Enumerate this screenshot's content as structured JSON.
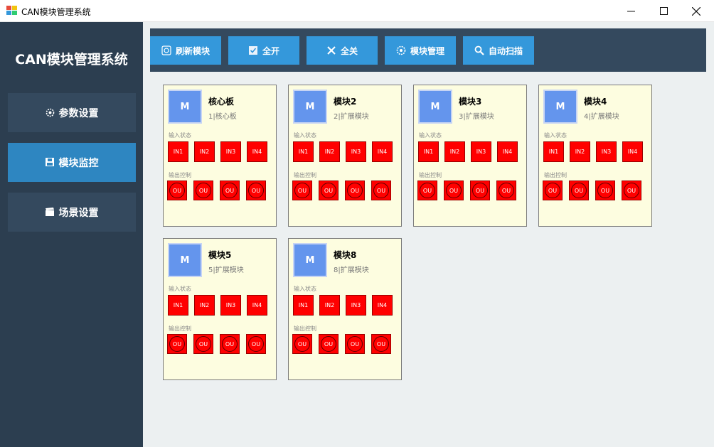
{
  "window": {
    "title": "CAN模块管理系统"
  },
  "sidebar": {
    "title": "CAN模块管理系统",
    "items": [
      {
        "label": "参数设置",
        "icon": "gear-icon"
      },
      {
        "label": "模块监控",
        "icon": "save-icon",
        "active": true
      },
      {
        "label": "场景设置",
        "icon": "clapperboard-icon"
      }
    ]
  },
  "toolbar": {
    "buttons": [
      {
        "label": "刷新模块",
        "icon": "refresh-icon"
      },
      {
        "label": "全开",
        "icon": "check-icon"
      },
      {
        "label": "全关",
        "icon": "close-icon"
      },
      {
        "label": "模块管理",
        "icon": "gear-icon"
      },
      {
        "label": "自动扫描",
        "icon": "search-icon"
      }
    ]
  },
  "labels": {
    "input_status": "输入状态",
    "output_control": "输出控制"
  },
  "modules": [
    {
      "avatar": "M",
      "name": "核心板",
      "sub": "1|核心板"
    },
    {
      "avatar": "M",
      "name": "模块2",
      "sub": "2|扩展模块"
    },
    {
      "avatar": "M",
      "name": "模块3",
      "sub": "3|扩展模块"
    },
    {
      "avatar": "M",
      "name": "模块4",
      "sub": "4|扩展模块"
    },
    {
      "avatar": "M",
      "name": "模块5",
      "sub": "5|扩展模块"
    },
    {
      "avatar": "M",
      "name": "模块8",
      "sub": "8|扩展模块"
    }
  ],
  "inputs": [
    "IN1",
    "IN2",
    "IN3",
    "IN4"
  ],
  "outputs": [
    "OU",
    "OU",
    "OU",
    "OU"
  ],
  "colors": {
    "sidebar_bg": "#2c3e50",
    "nav_item": "#34495e",
    "nav_active": "#2e86c1",
    "button": "#3498db",
    "card_bg": "#fdfde0",
    "io_red": "#ff0000",
    "avatar_blue": "#6495ed"
  }
}
